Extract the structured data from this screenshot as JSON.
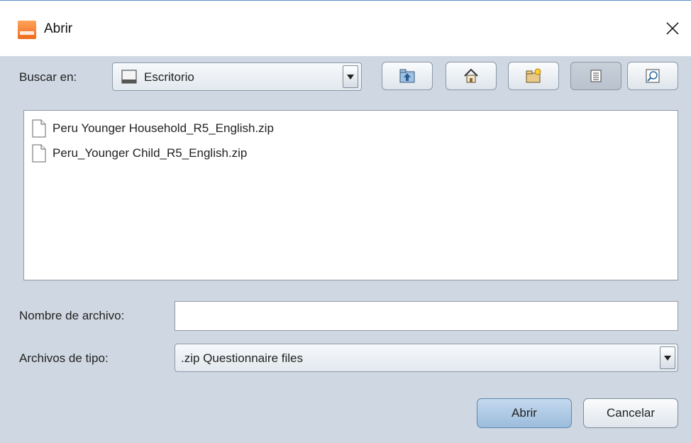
{
  "window": {
    "title": "Abrir",
    "close_glyph": "✕"
  },
  "toolbar": {
    "look_in_label": "Buscar en:",
    "look_in_value": "Escritorio",
    "buttons": [
      "up-folder-icon",
      "home-icon",
      "new-folder-icon",
      "list-view-icon",
      "details-view-icon"
    ]
  },
  "files": [
    {
      "name": "Peru Younger Household_R5_English.zip"
    },
    {
      "name": "Peru_Younger Child_R5_English.zip"
    }
  ],
  "filename": {
    "label": "Nombre de archivo:",
    "value": ""
  },
  "filetype": {
    "label": "Archivos de tipo:",
    "value": ".zip Questionnaire files"
  },
  "actions": {
    "open_label": "Abrir",
    "cancel_label": "Cancelar"
  }
}
